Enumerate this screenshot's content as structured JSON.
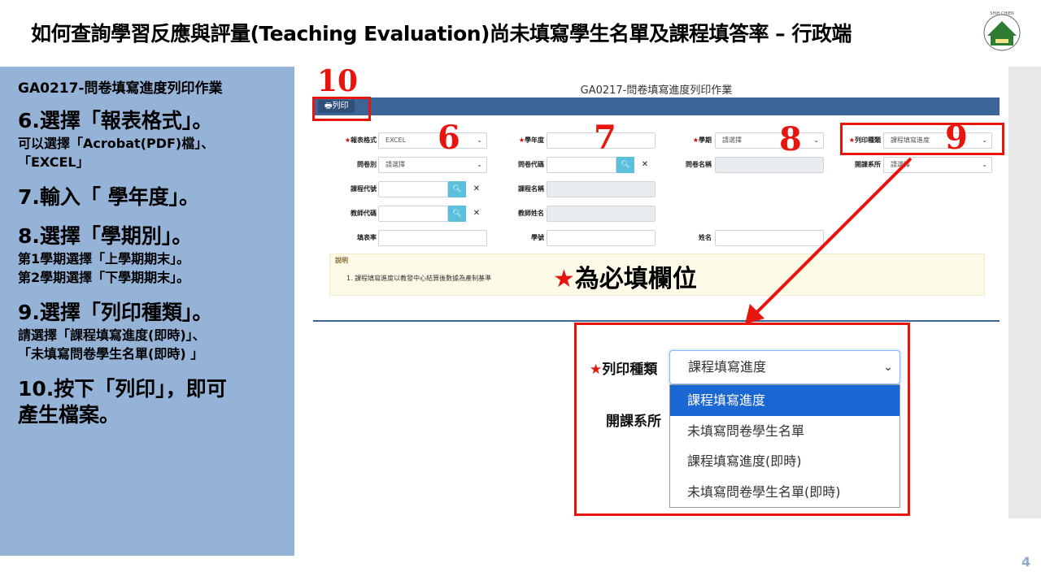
{
  "slide": {
    "title": "如何查詢學習反應與評量(Teaching Evaluation)尚未填寫學生名單及課程填答率 – 行政端",
    "page_number": "4",
    "logo_text": "SHIH CHIEN UNIVERSITY 實踐"
  },
  "instructions": {
    "heading": "GA0217-問卷填寫進度列印作業",
    "step6_title": "6.選擇「報表格式」。",
    "step6_desc1": "可以選擇「Acrobat(PDF)檔」、",
    "step6_desc2": "「EXCEL」",
    "step7_title": "7.輸入「 學年度」。",
    "step8_title": "8.選擇「學期別」。",
    "step8_desc1": "第1學期選擇「上學期期末」。",
    "step8_desc2": "第2學期選擇「下學期期末」。",
    "step9_title": "9.選擇「列印種類」。",
    "step9_desc1": " 請選擇「課程填寫進度(即時)」、",
    "step9_desc2": "「未填寫問卷學生名單(即時) 」",
    "step10_title1": "10.按下「列印」，即可",
    "step10_title2": "產生檔案。"
  },
  "screen": {
    "title": "GA0217-問卷填寫進度列印作業",
    "print_button": "🖶列印",
    "required_mark": "★",
    "fields": {
      "report_format_label": "報表格式",
      "report_format_value": "EXCEL",
      "academic_year_label": "學年度",
      "academic_year_value": "",
      "semester_label": "學期",
      "semester_value": "請選擇",
      "print_type_label": "列印種類",
      "print_type_value": "課程填寫進度",
      "questionnaire_type_label": "問卷別",
      "questionnaire_type_value": "請選擇",
      "questionnaire_code_label": "問卷代碼",
      "questionnaire_name_label": "問卷名稱",
      "department_label": "開課系所",
      "department_value": "請選擇",
      "course_code_label": "課程代號",
      "course_name_label": "課程名稱",
      "teacher_code_label": "教師代碼",
      "teacher_name_label": "教師姓名",
      "fill_rate_label": "填表率",
      "student_id_label": "學號",
      "name_label": "姓名"
    },
    "note_heading": "說明",
    "note_text": "1. 課程填寫進度以教發中心結算後數據為產制基準"
  },
  "callouts": {
    "n10": "10",
    "n6": "6",
    "n7": "7",
    "n8": "8",
    "n9": "9",
    "required_star": "★",
    "required_text": "為必填欄位"
  },
  "zoom": {
    "star": "★",
    "print_type_label": "列印種類",
    "department_label": "開課系所",
    "selected_value": "課程填寫進度",
    "options": [
      "課程填寫進度",
      "未填寫問卷學生名單",
      "課程填寫進度(即時)",
      "未填寫問卷學生名單(即時)"
    ],
    "highlighted_index": 0
  },
  "colors": {
    "accent_red": "#e8150f",
    "toolbar_blue": "#3b6596",
    "panel_blue": "#95b3d7",
    "highlight_blue": "#1a66d2"
  }
}
